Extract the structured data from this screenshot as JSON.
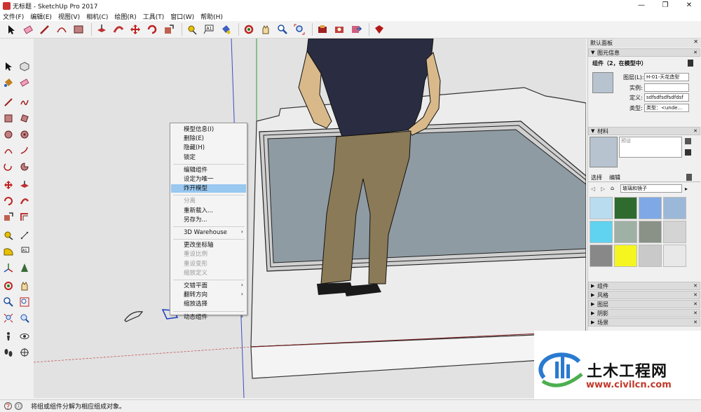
{
  "window": {
    "title": "无标题 - SketchUp Pro 2017",
    "minimize": "—",
    "maximize": "❐",
    "close": "✕"
  },
  "menu": [
    "文件(F)",
    "编辑(E)",
    "视图(V)",
    "相机(C)",
    "绘图(R)",
    "工具(T)",
    "窗口(W)",
    "帮助(H)"
  ],
  "context_menu": {
    "items": [
      {
        "label": "模型信息(I)",
        "enabled": true,
        "highlight": false
      },
      {
        "label": "删除(E)",
        "enabled": true,
        "highlight": false
      },
      {
        "label": "隐藏(H)",
        "enabled": true,
        "highlight": false
      },
      {
        "label": "锁定",
        "enabled": true,
        "highlight": false
      },
      {
        "sep": true
      },
      {
        "label": "编辑组件",
        "enabled": true,
        "highlight": false
      },
      {
        "label": "设定为唯一",
        "enabled": true,
        "highlight": false
      },
      {
        "label": "炸开模型",
        "enabled": true,
        "highlight": true
      },
      {
        "sep": true
      },
      {
        "label": "分离",
        "enabled": false,
        "highlight": false
      },
      {
        "label": "重新载入...",
        "enabled": true,
        "highlight": false
      },
      {
        "label": "另存为...",
        "enabled": true,
        "highlight": false
      },
      {
        "sep": true
      },
      {
        "label": "3D Warehouse",
        "enabled": true,
        "highlight": false,
        "submenu": true
      },
      {
        "sep": true
      },
      {
        "label": "更改坐标轴",
        "enabled": true,
        "highlight": false
      },
      {
        "label": "重设比例",
        "enabled": false,
        "highlight": false
      },
      {
        "label": "重设变形",
        "enabled": false,
        "highlight": false
      },
      {
        "label": "缩放定义",
        "enabled": false,
        "highlight": false
      },
      {
        "sep": true
      },
      {
        "label": "交错平面",
        "enabled": true,
        "highlight": false,
        "submenu": true
      },
      {
        "label": "翻转方向",
        "enabled": true,
        "highlight": false,
        "submenu": true
      },
      {
        "label": "缩放选择",
        "enabled": true,
        "highlight": false
      },
      {
        "sep": true
      },
      {
        "label": "动态组件",
        "enabled": true,
        "highlight": false,
        "submenu": true
      }
    ],
    "submenu_arrow": "›"
  },
  "tray": {
    "title": "默认面板",
    "entity_info": {
      "header": "图元信息",
      "summary": "组件（2，在模型中）",
      "layer_label": "图层(L):",
      "layer_value": "H-01-天花造型",
      "instance_label": "实例:",
      "instance_value": "",
      "definition_label": "定义:",
      "definition_value": "sdfsdfsdfsdfdsf",
      "type_label": "类型:",
      "type_value": "类型：<unde..."
    },
    "materials": {
      "header": "材料",
      "name_placeholder": "预设",
      "tab_select": "选择",
      "tab_edit": "编辑",
      "library": "玻璃和镜子",
      "swatch_colors": [
        "#b9dcef",
        "#2f6b2f",
        "#7fa9e6",
        "#9cb8d8",
        "#5fd3ef",
        "#9fb1a4",
        "#8a9288",
        "#d4d4d4",
        "#888888",
        "#f5f520",
        "#c9c9c9",
        "#e8e8e8"
      ]
    },
    "collapsed": [
      "组件",
      "风格",
      "图层",
      "阴影",
      "场景"
    ]
  },
  "status": {
    "text": "将组或组件分解为相应组成对象。",
    "icons": [
      "❓",
      "ⓘ"
    ]
  },
  "watermark": {
    "name": "土木工程网",
    "url": "www.civilcn.com"
  }
}
